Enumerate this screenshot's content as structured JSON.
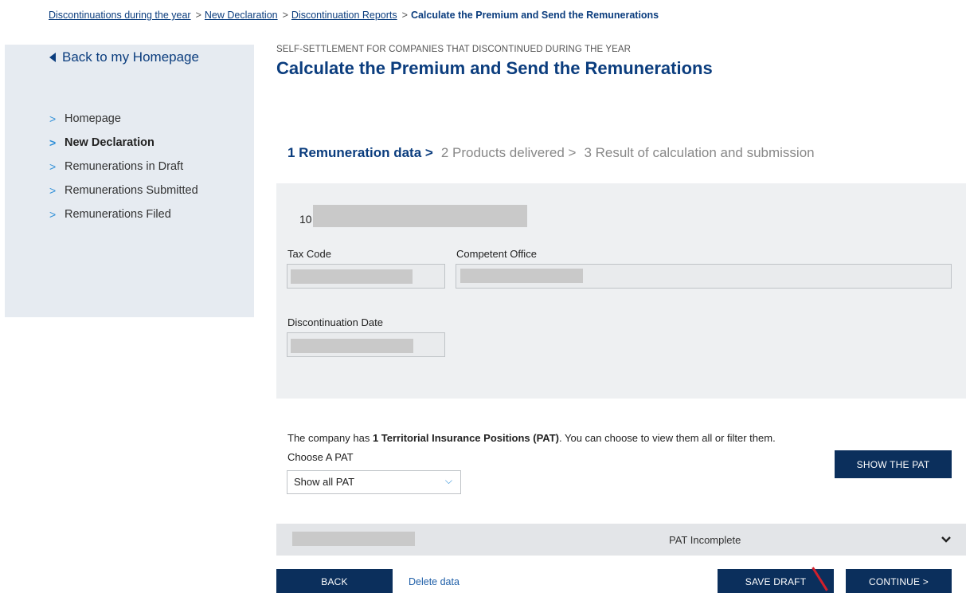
{
  "breadcrumb": {
    "items": [
      "Discontinuations during the year",
      "New Declaration",
      "Discontinuation Reports"
    ],
    "current": "Calculate the Premium and Send the Remunerations",
    "separator": ">"
  },
  "sidebar": {
    "back_label": "Back to my Homepage",
    "items": [
      {
        "label": "Homepage"
      },
      {
        "label": "New Declaration"
      },
      {
        "label": "Remunerations in Draft"
      },
      {
        "label": "Remunerations Submitted"
      },
      {
        "label": "Remunerations Filed"
      }
    ],
    "chevron": ">"
  },
  "header": {
    "eyebrow": "SELF-SETTLEMENT FOR COMPANIES THAT DISCONTINUED DURING THE YEAR",
    "title": "Calculate the Premium and Send the Remunerations"
  },
  "steps": {
    "active": "1 Remuneration data >",
    "step2": "2 Products delivered >",
    "step3": "3 Result of calculation and submission"
  },
  "form": {
    "code_prefix": "10",
    "tax_code_label": "Tax Code",
    "competent_office_label": "Competent Office",
    "discontinuation_date_label": "Discontinuation Date"
  },
  "pat": {
    "info_prefix": "The company has ",
    "info_bold": "1 Territorial Insurance Positions (PAT)",
    "info_suffix": ". You can choose to view them all or filter them.",
    "choose_label": "Choose A PAT",
    "selected": "Show all PAT",
    "show_button": "SHOW THE PAT",
    "status": "PAT Incomplete"
  },
  "footer": {
    "back": "BACK",
    "delete": "Delete data",
    "save_draft": "SAVE DRAFT",
    "continue": "CONTINUE >"
  },
  "colors": {
    "primary": "#0b2f5c",
    "link": "#0b3d7e",
    "accent": "#2f8fd8"
  },
  "icons": {
    "back": "triangle-left-icon",
    "menu": "chevron-right-icon",
    "select": "chevron-down-icon",
    "expand": "chevron-down-icon"
  }
}
